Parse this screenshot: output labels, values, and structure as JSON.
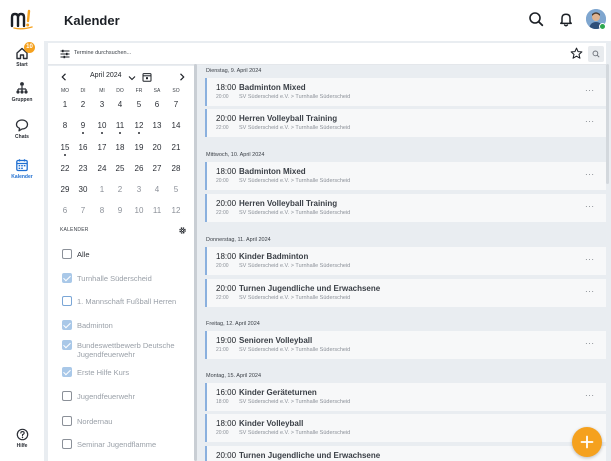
{
  "app": {
    "title": "Kalender",
    "colors": {
      "accent": "#1f6fd1",
      "badge": "#f5a11e",
      "fab": "#f5a11e",
      "online": "#2fa84f"
    }
  },
  "rail": {
    "logo_icon": "m-logo",
    "items": [
      {
        "label": "Start",
        "icon": "home-icon",
        "badge": "10"
      },
      {
        "label": "Gruppen",
        "icon": "groups-icon"
      },
      {
        "label": "Chats",
        "icon": "chat-icon"
      },
      {
        "label": "Kalender",
        "icon": "calendar-icon",
        "active": true
      }
    ],
    "help_label": "Hilfe"
  },
  "header": {
    "icons": [
      "search-icon",
      "bell-icon",
      "avatar"
    ]
  },
  "search": {
    "placeholder": "Termine durchsuchen..."
  },
  "calendar": {
    "month_label": "April 2024",
    "weekdays": [
      "MO",
      "DI",
      "MI",
      "DO",
      "FR",
      "SA",
      "SO"
    ],
    "weeks": [
      [
        "1",
        "2",
        "3",
        "4",
        "5",
        "6",
        "7"
      ],
      [
        "8",
        "9",
        "10",
        "11",
        "12",
        "13",
        "14"
      ],
      [
        "15",
        "16",
        "17",
        "18",
        "19",
        "20",
        "21"
      ],
      [
        "22",
        "23",
        "24",
        "25",
        "26",
        "27",
        "28"
      ],
      [
        "29",
        "30",
        "1",
        "2",
        "3",
        "4",
        "5"
      ],
      [
        "6",
        "7",
        "8",
        "9",
        "10",
        "11",
        "12"
      ]
    ]
  },
  "calendars": {
    "heading": "KALENDER",
    "items": [
      {
        "label": "Alle",
        "state": "off"
      },
      {
        "label": "Turnhalle Süderscheid",
        "state": "on"
      },
      {
        "label": "1. Mannschaft Fußball Herren",
        "state": "off-blue"
      },
      {
        "label": "Badminton",
        "state": "on"
      },
      {
        "label": "Bundeswettbewerb Deutsche Jugendfeuerwehr",
        "state": "on"
      },
      {
        "label": "Erste Hilfe Kurs",
        "state": "on"
      },
      {
        "label": "Jugendfeuerwehr",
        "state": "off"
      },
      {
        "label": "Nordernau",
        "state": "off"
      },
      {
        "label": "Seminar Jugendflamme",
        "state": "off"
      }
    ]
  },
  "events": {
    "more_label": "···",
    "days": [
      {
        "heading": "Dienstag, 9. April 2024",
        "items": [
          {
            "start": "18:00",
            "end": "20:00",
            "title": "Badminton Mixed",
            "location": "SV Süderscheid e.V. > Turnhalle Süderscheid"
          },
          {
            "start": "20:00",
            "end": "22:00",
            "title": "Herren Volleyball Training",
            "location": "SV Süderscheid e.V. > Turnhalle Süderscheid"
          }
        ]
      },
      {
        "heading": "Mittwoch, 10. April 2024",
        "items": [
          {
            "start": "18:00",
            "end": "20:00",
            "title": "Badminton Mixed",
            "location": "SV Süderscheid e.V. > Turnhalle Süderscheid"
          },
          {
            "start": "20:00",
            "end": "22:00",
            "title": "Herren Volleyball Training",
            "location": "SV Süderscheid e.V. > Turnhalle Süderscheid"
          }
        ]
      },
      {
        "heading": "Donnerstag, 11. April 2024",
        "items": [
          {
            "start": "18:00",
            "end": "20:00",
            "title": "Kinder Badminton",
            "location": "SV Süderscheid e.V. > Turnhalle Süderscheid"
          },
          {
            "start": "20:00",
            "end": "22:00",
            "title": "Turnen Jugendliche und Erwachsene",
            "location": "SV Süderscheid e.V. > Turnhalle Süderscheid"
          }
        ]
      },
      {
        "heading": "Freitag, 12. April 2024",
        "items": [
          {
            "start": "19:00",
            "end": "21:00",
            "title": "Senioren Volleyball",
            "location": "SV Süderscheid e.V. > Turnhalle Süderscheid"
          }
        ]
      },
      {
        "heading": "Montag, 15. April 2024",
        "items": [
          {
            "start": "16:00",
            "end": "18:00",
            "title": "Kinder Geräteturnen",
            "location": "SV Süderscheid e.V. > Turnhalle Süderscheid"
          },
          {
            "start": "18:00",
            "end": "20:00",
            "title": "Kinder Volleyball",
            "location": "SV Süderscheid e.V. > Turnhalle Süderscheid"
          },
          {
            "start": "20:00",
            "end": "",
            "title": "Turnen Jugendliche und Erwachsene",
            "location": ""
          }
        ]
      }
    ]
  }
}
